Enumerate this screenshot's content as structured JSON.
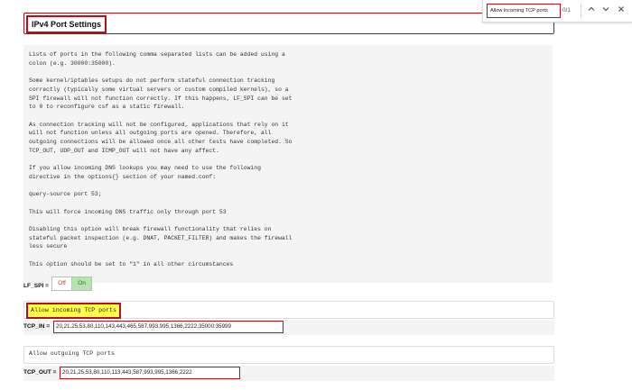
{
  "section_title": "IPv4 Port Settings",
  "help_lines": [
    "Lists of ports in the following comma separated lists can be added using a",
    "colon (e.g. 30000:35000).",
    "",
    "Some kernel/iptables setups do not perform stateful connection tracking",
    "correctly (typically some virtual servers or custom compiled kernels), so a",
    "SPI firewall will not function correctly. If this happens, LF_SPI can be set",
    "to 0 to reconfigure csf as a static firewall.",
    "",
    "As connection tracking will not be configured, applications that rely on it",
    "will not function unless all outgoing ports are opened. Therefore, all",
    "outgoing connections will be allowed once all other tests have completed. So",
    "TCP_OUT, UDP_OUT and ICMP_OUT will not have any affect.",
    "",
    "If you allow incoming DNS lookups you may need to use the following",
    "directive in the options{} section of your named.conf:",
    "",
    "query-source port 53;",
    "",
    "This will force incoming DNS traffic only through port 53",
    "",
    "Disabling this option will break firewall functionality that relies on",
    "stateful packet inspection (e.g. DNAT, PACKET_FILTER) and makes the firewall",
    "less secure",
    "",
    "This option should be set to \"1\" in all other circumstances"
  ],
  "lf_spi": {
    "label": "LF_SPI =",
    "off": "Off",
    "on": "On",
    "selected": "On"
  },
  "tcp_in": {
    "description": "Allow incoming TCP ports",
    "label": "TCP_IN =",
    "value": "20,21,25,53,80,110,143,443,465,587,993,995,1366,2222,35000:35999"
  },
  "tcp_out": {
    "description": "Allow outgoing TCP ports",
    "label": "TCP_OUT =",
    "value": "20,21,25,53,80,110,113,443,587,993,995,1366,2222"
  },
  "find_bar": {
    "query": "Allow incoming TCP ports",
    "count": "0/1",
    "prev_icon": "chevron-up-icon",
    "next_icon": "chevron-down-icon",
    "close_icon": "close-icon"
  },
  "colors": {
    "highlight_border": "#b80e1a",
    "match_highlight": "#ffff47",
    "on_green": "#b6e3b0"
  }
}
